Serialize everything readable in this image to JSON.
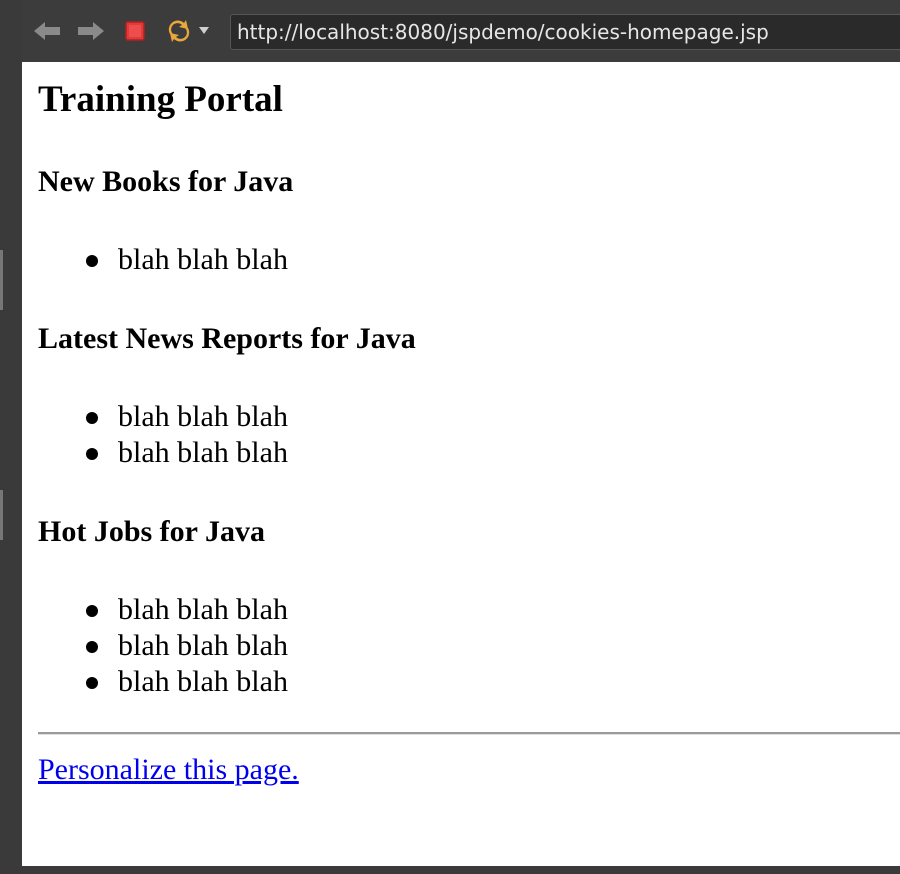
{
  "browser": {
    "url": "http://localhost:8080/jspdemo/cookies-homepage.jsp",
    "icons": {
      "back": "back-arrow-icon",
      "forward": "forward-arrow-icon",
      "stop": "stop-icon",
      "reload": "reload-icon",
      "dropdown": "dropdown-arrow-icon"
    }
  },
  "page": {
    "title": "Training Portal",
    "sections": [
      {
        "heading": "New Books for Java",
        "items": [
          "blah blah blah"
        ]
      },
      {
        "heading": "Latest News Reports for Java",
        "items": [
          "blah blah blah",
          "blah blah blah"
        ]
      },
      {
        "heading": "Hot Jobs for Java",
        "items": [
          "blah blah blah",
          "blah blah blah",
          "blah blah blah"
        ]
      }
    ],
    "personalize_link": "Personalize this page."
  },
  "colors": {
    "link": "#0000ee",
    "stop_button": "#e03a3a",
    "reload_icon": "#e8a83a"
  }
}
